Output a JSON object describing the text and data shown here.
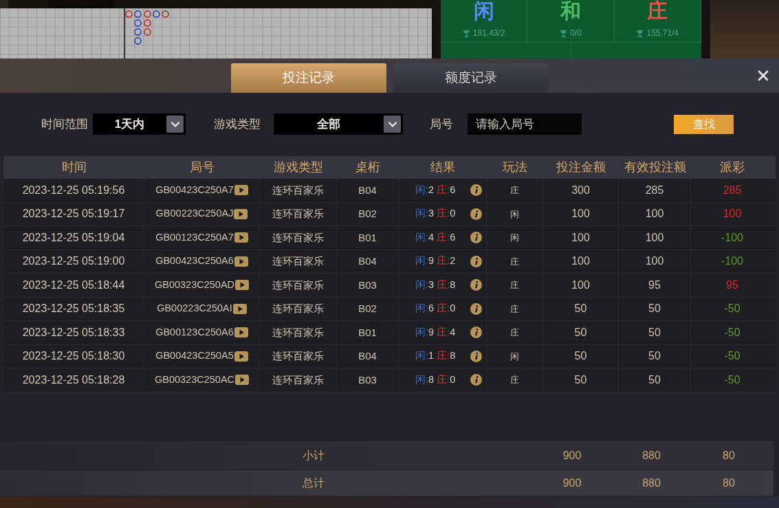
{
  "background": {
    "roadmap": {
      "columns": [
        [
          {
            "kind": "banker",
            "tie": false
          }
        ],
        [
          {
            "kind": "player",
            "tie": false
          },
          {
            "kind": "player",
            "tie": false
          },
          {
            "kind": "player",
            "tie": false
          },
          {
            "kind": "player",
            "tie": false
          }
        ],
        [
          {
            "kind": "banker",
            "tie": false
          },
          {
            "kind": "banker",
            "tie": false
          },
          {
            "kind": "banker",
            "tie": false
          }
        ],
        [
          {
            "kind": "player",
            "tie": false
          }
        ],
        [
          {
            "kind": "banker",
            "tie": true
          }
        ]
      ]
    },
    "bet_panel": {
      "options": [
        {
          "label": "闲",
          "kind": "player",
          "stat": "191.43/2"
        },
        {
          "label": "和",
          "kind": "tie",
          "stat": "0/0"
        },
        {
          "label": "庄",
          "kind": "banker",
          "stat": "155.71/4"
        }
      ]
    }
  },
  "dialog": {
    "tabs": [
      {
        "label": "投注记录",
        "selected": true
      },
      {
        "label": "额度记录",
        "selected": false
      }
    ],
    "filters": {
      "time_range": {
        "label": "时间范围",
        "value": "1天内"
      },
      "game_type": {
        "label": "游戏类型",
        "value": "全部"
      },
      "round_no": {
        "label": "局号",
        "placeholder": "请输入局号"
      },
      "search_button": "查找"
    },
    "table": {
      "columns": [
        "时间",
        "局号",
        "游戏类型",
        "桌桁",
        "结果",
        "玩法",
        "投注金额",
        "有效投注额",
        "派彩"
      ],
      "rows": [
        {
          "time": "2023-12-25 05:19:56",
          "round": "GB00423C250A7",
          "game": "连环百家乐",
          "table": "B04",
          "result": {
            "player_label": "闲:",
            "player_score": "2",
            "banker_label": "庄:",
            "banker_score": "6"
          },
          "bet_on": "庄",
          "amount": "300",
          "valid_amount": "285",
          "payout": {
            "text": "285",
            "color": "#e0262b"
          }
        },
        {
          "time": "2023-12-25 05:19:17",
          "round": "GB00223C250AJ",
          "game": "连环百家乐",
          "table": "B02",
          "result": {
            "player_label": "闲:",
            "player_score": "3",
            "banker_label": "庄:",
            "banker_score": "0"
          },
          "bet_on": "闲",
          "amount": "100",
          "valid_amount": "100",
          "payout": {
            "text": "100",
            "color": "#e0262b"
          }
        },
        {
          "time": "2023-12-25 05:19:04",
          "round": "GB00123C250A7",
          "game": "连环百家乐",
          "table": "B01",
          "result": {
            "player_label": "闲:",
            "player_score": "4",
            "banker_label": "庄:",
            "banker_score": "6"
          },
          "bet_on": "闲",
          "amount": "100",
          "valid_amount": "100",
          "payout": {
            "text": "-100",
            "color": "#5e9e2a"
          }
        },
        {
          "time": "2023-12-25 05:19:00",
          "round": "GB00423C250A6",
          "game": "连环百家乐",
          "table": "B04",
          "result": {
            "player_label": "闲:",
            "player_score": "9",
            "banker_label": "庄:",
            "banker_score": "2"
          },
          "bet_on": "庄",
          "amount": "100",
          "valid_amount": "100",
          "payout": {
            "text": "-100",
            "color": "#5e9e2a"
          }
        },
        {
          "time": "2023-12-25 05:18:44",
          "round": "GB00323C250AD",
          "game": "连环百家乐",
          "table": "B03",
          "result": {
            "player_label": "闲:",
            "player_score": "3",
            "banker_label": "庄:",
            "banker_score": "8"
          },
          "bet_on": "庄",
          "amount": "100",
          "valid_amount": "95",
          "payout": {
            "text": "95",
            "color": "#e0262b"
          }
        },
        {
          "time": "2023-12-25 05:18:35",
          "round": "GB00223C250AI",
          "game": "连环百家乐",
          "table": "B02",
          "result": {
            "player_label": "闲:",
            "player_score": "6",
            "banker_label": "庄:",
            "banker_score": "0"
          },
          "bet_on": "庄",
          "amount": "50",
          "valid_amount": "50",
          "payout": {
            "text": "-50",
            "color": "#5e9e2a"
          }
        },
        {
          "time": "2023-12-25 05:18:33",
          "round": "GB00123C250A6",
          "game": "连环百家乐",
          "table": "B01",
          "result": {
            "player_label": "闲:",
            "player_score": "9",
            "banker_label": "庄:",
            "banker_score": "4"
          },
          "bet_on": "庄",
          "amount": "50",
          "valid_amount": "50",
          "payout": {
            "text": "-50",
            "color": "#5e9e2a"
          }
        },
        {
          "time": "2023-12-25 05:18:30",
          "round": "GB00423C250A5",
          "game": "连环百家乐",
          "table": "B04",
          "result": {
            "player_label": "闲:",
            "player_score": "1",
            "banker_label": "庄:",
            "banker_score": "8"
          },
          "bet_on": "闲",
          "amount": "50",
          "valid_amount": "50",
          "payout": {
            "text": "-50",
            "color": "#5e9e2a"
          }
        },
        {
          "time": "2023-12-25 05:18:28",
          "round": "GB00323C250AC",
          "game": "连环百家乐",
          "table": "B03",
          "result": {
            "player_label": "闲:",
            "player_score": "8",
            "banker_label": "庄:",
            "banker_score": "0"
          },
          "bet_on": "庄",
          "amount": "50",
          "valid_amount": "50",
          "payout": {
            "text": "-50",
            "color": "#5e9e2a"
          }
        }
      ],
      "subtotal": {
        "label": "小计",
        "amount": "900",
        "valid_amount": "880",
        "payout": "80"
      },
      "total": {
        "label": "总计",
        "amount": "900",
        "valid_amount": "880",
        "payout": "80"
      }
    }
  }
}
